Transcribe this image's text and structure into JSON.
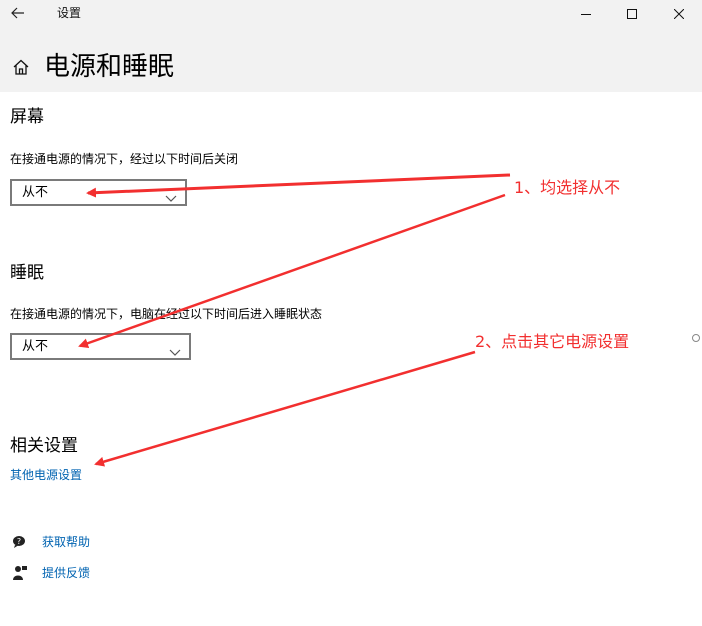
{
  "window": {
    "title": "设置",
    "back_icon": "back-arrow-icon",
    "minimize_icon": "minimize-icon",
    "maximize_icon": "maximize-icon",
    "close_icon": "close-icon"
  },
  "header": {
    "home_icon": "home-icon",
    "title": "电源和睡眠"
  },
  "screen": {
    "heading": "屏幕",
    "label": "在接通电源的情况下，经过以下时间后关闭",
    "selected": "从不"
  },
  "sleep": {
    "heading": "睡眠",
    "label": "在接通电源的情况下，电脑在经过以下时间后进入睡眠状态",
    "selected": "从不"
  },
  "related": {
    "heading": "相关设置",
    "link": "其他电源设置"
  },
  "help": {
    "items": [
      {
        "icon": "help-chat-icon",
        "label": "获取帮助"
      },
      {
        "icon": "feedback-person-icon",
        "label": "提供反馈"
      }
    ]
  },
  "annotations": {
    "step1": "1、均选择从不",
    "step2": "2、点击其它电源设置",
    "color": "#f22f2f"
  },
  "colors": {
    "link": "#0063b1",
    "header_bg": "#f2f2f2"
  }
}
